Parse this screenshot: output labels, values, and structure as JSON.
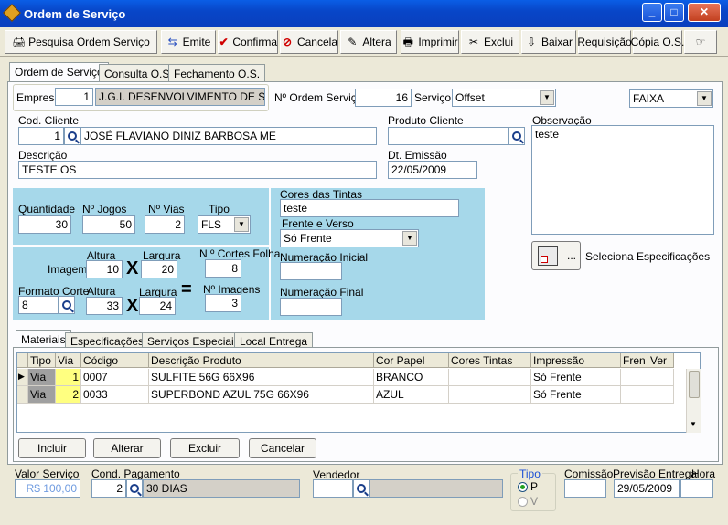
{
  "window": {
    "title": "Ordem de Serviço",
    "min": "_",
    "max": "□",
    "close": "✕"
  },
  "toolbar": [
    {
      "label": "Pesquisa Ordem Serviço",
      "icon": "🖨"
    },
    {
      "label": "Emite",
      "icon": "⇆"
    },
    {
      "label": "Confirma",
      "icon": "✔"
    },
    {
      "label": "Cancela",
      "icon": "⊘"
    },
    {
      "label": "Altera",
      "icon": "✎"
    },
    {
      "label": "Imprimir",
      "icon": "🖶"
    },
    {
      "label": "Exclui",
      "icon": "✂"
    },
    {
      "label": "Baixar",
      "icon": "⇩"
    },
    {
      "label": "Requisição",
      "icon": ""
    },
    {
      "label": "Cópia O.S.",
      "icon": ""
    },
    {
      "label": "",
      "icon": "☞"
    }
  ],
  "tabs": [
    "Ordem de Serviço",
    "Consulta O.S.",
    "Fechamento O.S."
  ],
  "header": {
    "empresa_label": "Empresa",
    "empresa_code": "1",
    "empresa_name": "J.G.I. DESENVOLVIMENTO DE SOF",
    "os_label": "Nº Ordem Serviço",
    "os_number": "16",
    "servico_label": "Serviço",
    "servico_value": "Offset",
    "faixa_value": "FAIXA"
  },
  "cliente": {
    "label": "Cod. Cliente",
    "code": "1",
    "name": "JOSÉ FLAVIANO DINIZ BARBOSA ME",
    "produto_label": "Produto Cliente",
    "produto_value": "",
    "obs_label": "Observação",
    "obs_value": "teste",
    "descricao_label": "Descrição",
    "descricao_value": "TESTE OS",
    "emissao_label": "Dt. Emissão",
    "emissao_value": "22/05/2009"
  },
  "spec": {
    "quantidade_label": "Quantidade",
    "quantidade": "30",
    "jogos_label": "Nº Jogos",
    "jogos": "50",
    "vias_label": "Nº Vias",
    "vias": "2",
    "tipo_label": "Tipo",
    "tipo": "FLS",
    "cores_label": "Cores das Tintas",
    "cores": "teste",
    "frente_label": "Frente e Verso",
    "frente": "Só Frente",
    "imagem_label": "Imagem",
    "altura_label": "Altura",
    "largura_label": "Largura",
    "img_altura": "10",
    "img_largura": "20",
    "cortes_label": "N º Cortes Folha",
    "cortes": "8",
    "formato_label": "Formato Corte",
    "formato": "8",
    "fc_altura": "33",
    "fc_largura": "24",
    "nimagens_label": "Nº Imagens",
    "nimagens": "3",
    "num_ini_label": "Numeração Inicial",
    "num_ini": "",
    "num_fin_label": "Numeração Final",
    "num_fin": "",
    "x1": "X",
    "x2": "X",
    "eq": "=",
    "seleciona_label": "Seleciona Especificações",
    "seleciona_dots": "..."
  },
  "subtabs": [
    "Materiais",
    "Especificações",
    "Serviços Especiais",
    "Local Entrega"
  ],
  "grid": {
    "columns": [
      "Tipo",
      "Via",
      "Código",
      "Descrição Produto",
      "Cor Papel",
      "Cores Tintas",
      "Impressão",
      "Fren",
      "Ver"
    ],
    "rows": [
      {
        "tipo": "Via",
        "via": "1",
        "codigo": "0007",
        "descricao": "SULFITE 56G 66X96",
        "cor": "BRANCO",
        "cores": "",
        "impressao": "Só Frente",
        "fren": "",
        "ver": ""
      },
      {
        "tipo": "Via",
        "via": "2",
        "codigo": "0033",
        "descricao": "SUPERBOND AZUL 75G 66X96",
        "cor": "AZUL",
        "cores": "",
        "impressao": "Só Frente",
        "fren": "",
        "ver": ""
      }
    ]
  },
  "grid_buttons": [
    "Incluir",
    "Alterar",
    "Excluir",
    "Cancelar"
  ],
  "footer": {
    "valor_label": "Valor Serviço",
    "valor": "R$ 100,00",
    "cond_label": "Cond. Pagamento",
    "cond_code": "2",
    "cond_name": "30 DIAS",
    "vendedor_label": "Vendedor",
    "vendedor_code": "",
    "vendedor_name": "",
    "tipo_label": "Tipo",
    "tipo_p": "P",
    "tipo_v": "V",
    "comissao_label": "Comissão",
    "comissao": "",
    "previsao_label": "Previsão Entrega",
    "previsao": "29/05/2009",
    "hora_label": "Hora",
    "hora": ""
  }
}
